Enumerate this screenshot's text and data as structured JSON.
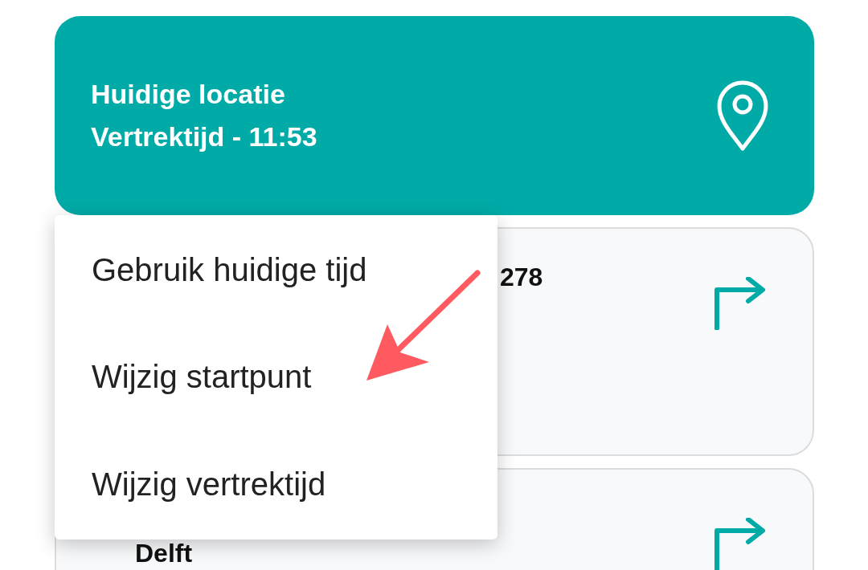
{
  "location_card": {
    "title": "Huidige locatie",
    "subtitle": "Vertrektijd - 11:53"
  },
  "route_cards": [
    {
      "text": "278"
    },
    {
      "text": "Delft"
    }
  ],
  "menu": {
    "items": [
      {
        "label": "Gebruik huidige tijd"
      },
      {
        "label": "Wijzig startpunt"
      },
      {
        "label": "Wijzig vertrektijd"
      }
    ]
  }
}
